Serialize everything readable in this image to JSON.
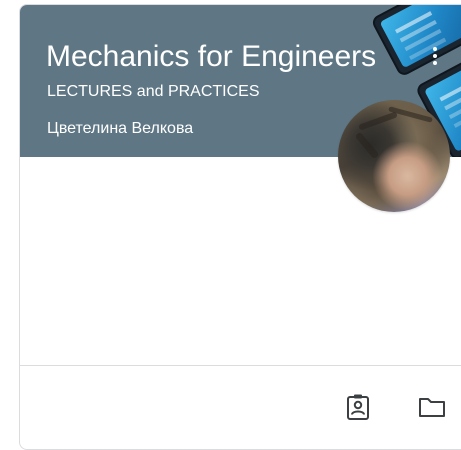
{
  "course_card": {
    "title": "Mechanics for Engineers",
    "section": "LECTURES and PRACTICES",
    "teacher": "Цветелина Велкова",
    "more_icon": "more-vert-icon",
    "avatar_icon": "teacher-avatar",
    "header_color": "#5f7785",
    "actions": [
      {
        "icon": "assignment-ind-icon"
      },
      {
        "icon": "folder-icon"
      }
    ]
  }
}
